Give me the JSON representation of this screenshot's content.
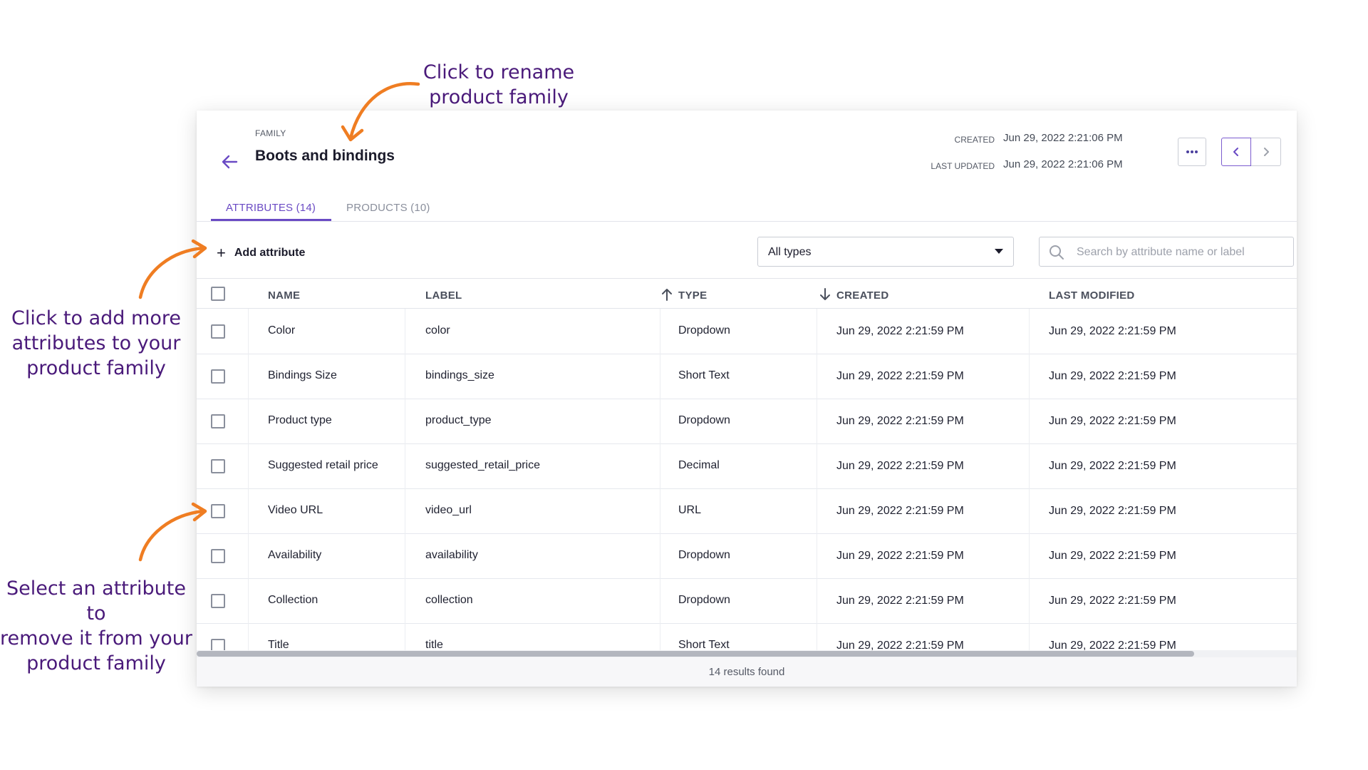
{
  "annotations": {
    "rename": [
      "Click to rename",
      "product family"
    ],
    "add": [
      "Click to add more",
      "attributes to your",
      "product family"
    ],
    "select": [
      "Select an attribute to",
      "remove it from your",
      "product family"
    ]
  },
  "colors": {
    "annotation_text": "#4a1a7a",
    "arrow": "#ef7d22",
    "accent": "#6a4ac4"
  },
  "header": {
    "family_label": "FAMILY",
    "title": "Boots and bindings",
    "created_label": "CREATED",
    "created_value": "Jun 29, 2022 2:21:06 PM",
    "updated_label": "LAST UPDATED",
    "updated_value": "Jun 29, 2022 2:21:06 PM",
    "more_icon": "ellipsis-icon",
    "prev_icon": "chevron-left-icon",
    "next_icon": "chevron-right-icon"
  },
  "tabs": [
    {
      "label": "ATTRIBUTES (14)",
      "active": true
    },
    {
      "label": "PRODUCTS (10)",
      "active": false
    }
  ],
  "toolbar": {
    "add_label": "Add attribute",
    "type_filter_value": "All types",
    "search_placeholder": "Search by attribute name or label"
  },
  "table": {
    "columns": [
      "NAME",
      "LABEL",
      "TYPE",
      "CREATED",
      "LAST MODIFIED"
    ],
    "rows": [
      {
        "name": "Color",
        "label": "color",
        "type": "Dropdown",
        "created": "Jun 29, 2022 2:21:59 PM",
        "modified": "Jun 29, 2022 2:21:59 PM"
      },
      {
        "name": "Bindings Size",
        "label": "bindings_size",
        "type": "Short Text",
        "created": "Jun 29, 2022 2:21:59 PM",
        "modified": "Jun 29, 2022 2:21:59 PM"
      },
      {
        "name": "Product type",
        "label": "product_type",
        "type": "Dropdown",
        "created": "Jun 29, 2022 2:21:59 PM",
        "modified": "Jun 29, 2022 2:21:59 PM"
      },
      {
        "name": "Suggested retail price",
        "label": "suggested_retail_price",
        "type": "Decimal",
        "created": "Jun 29, 2022 2:21:59 PM",
        "modified": "Jun 29, 2022 2:21:59 PM"
      },
      {
        "name": "Video URL",
        "label": "video_url",
        "type": "URL",
        "created": "Jun 29, 2022 2:21:59 PM",
        "modified": "Jun 29, 2022 2:21:59 PM"
      },
      {
        "name": "Availability",
        "label": "availability",
        "type": "Dropdown",
        "created": "Jun 29, 2022 2:21:59 PM",
        "modified": "Jun 29, 2022 2:21:59 PM"
      },
      {
        "name": "Collection",
        "label": "collection",
        "type": "Dropdown",
        "created": "Jun 29, 2022 2:21:59 PM",
        "modified": "Jun 29, 2022 2:21:59 PM"
      },
      {
        "name": "Title",
        "label": "title",
        "type": "Short Text",
        "created": "Jun 29, 2022 2:21:59 PM",
        "modified": "Jun 29, 2022 2:21:59 PM"
      }
    ]
  },
  "footer": {
    "results": "14 results found"
  }
}
